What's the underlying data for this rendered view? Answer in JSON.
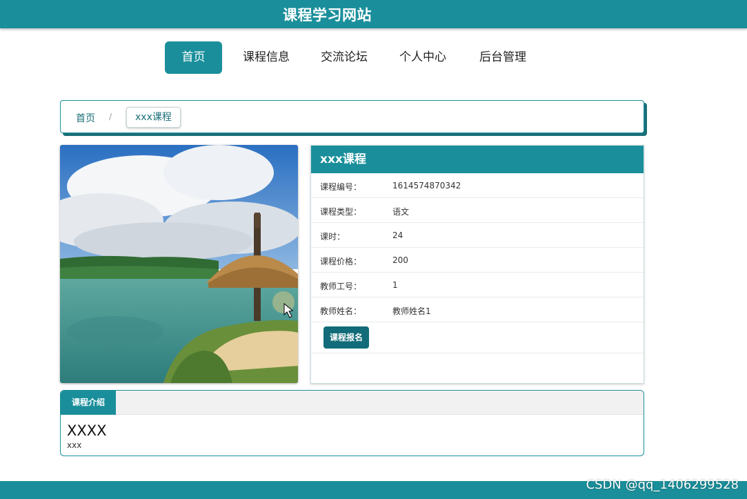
{
  "site": {
    "title": "课程学习网站"
  },
  "nav": [
    {
      "label": "首页",
      "active": true
    },
    {
      "label": "课程信息"
    },
    {
      "label": "交流论坛"
    },
    {
      "label": "个人中心"
    },
    {
      "label": "后台管理"
    }
  ],
  "breadcrumb": {
    "home": "首页",
    "separator": "/",
    "current": "xxx课程"
  },
  "course": {
    "name": "xxx课程",
    "fields": [
      {
        "label": "课程编号：",
        "value": "1614574870342"
      },
      {
        "label": "课程类型：",
        "value": "语文"
      },
      {
        "label": "课时：",
        "value": "24"
      },
      {
        "label": "课程价格：",
        "value": "200"
      },
      {
        "label": "教师工号：",
        "value": "1"
      },
      {
        "label": "教师姓名：",
        "value": "教师姓名1"
      }
    ],
    "enroll_label": "课程报名"
  },
  "intro": {
    "tab_label": "课程介绍",
    "title": "XXXX",
    "text": "xxx"
  },
  "watermark": "CSDN @qq_1406299528",
  "colors": {
    "primary": "#1a8f9b",
    "button": "#116b78"
  }
}
